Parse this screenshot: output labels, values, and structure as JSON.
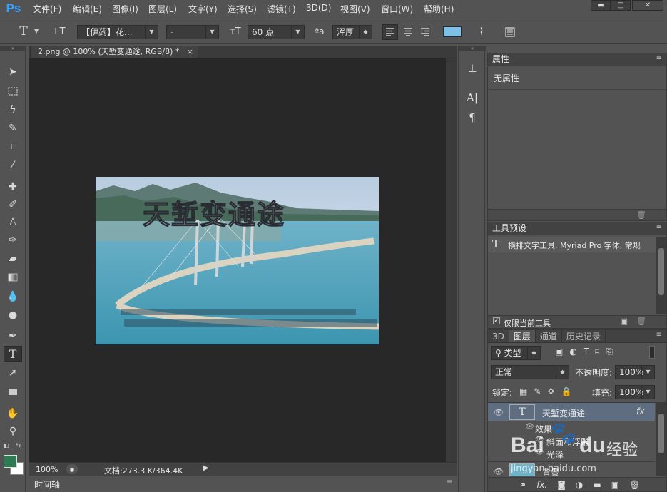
{
  "app": {
    "logo": "Ps",
    "menu": [
      "文件(F)",
      "编辑(E)",
      "图像(I)",
      "图层(L)",
      "文字(Y)",
      "选择(S)",
      "滤镜(T)",
      "3D(D)",
      "视图(V)",
      "窗口(W)",
      "帮助(H)"
    ],
    "window_controls": [
      "▬",
      "□",
      "✕"
    ]
  },
  "options_bar": {
    "font_family": "【伊蒟】花...",
    "font_style": "-",
    "font_size": "60 点",
    "anti_alias_label": "ªa",
    "anti_alias": "浑厚",
    "text_color": "#7ec0e8"
  },
  "document": {
    "tab_title": "2.png @ 100% (天堑变通途, RGB/8) *",
    "tab_close": "×",
    "canvas_text": "天堑变通途",
    "zoom": "100%",
    "doc_info": "文档:273.3 K/364.4K",
    "timeline": "时间轴"
  },
  "properties_panel": {
    "title": "属性",
    "content": "无属性"
  },
  "tool_presets_panel": {
    "title": "工具预设",
    "item": "横排文字工具, Myriad Pro 字体, 常规",
    "current_only": "仅限当前工具"
  },
  "layers_panel": {
    "tabs": [
      "3D",
      "图层",
      "通道",
      "历史记录"
    ],
    "active_tab": "图层",
    "filter": "类型",
    "blend_mode": "正常",
    "opacity_label": "不透明度:",
    "opacity": "100%",
    "lock_label": "锁定:",
    "fill_label": "填充:",
    "fill": "100%",
    "layers": [
      {
        "name": "天堑变通途",
        "fx": "fx",
        "type": "text"
      },
      {
        "name": "效果",
        "type": "effects"
      },
      {
        "name": "斜面和浮雕",
        "type": "effect"
      },
      {
        "name": "光泽",
        "type": "effect"
      },
      {
        "name": "背景",
        "type": "image"
      }
    ]
  },
  "watermark": {
    "brand": "Bai",
    "paw": "🐾",
    "du": "du",
    "cn": "经验",
    "url": "jingyan.baidu.com"
  },
  "colors": {
    "foreground": "#2f7a52",
    "background": "#ffffff",
    "accent": "#3aa0ff"
  }
}
